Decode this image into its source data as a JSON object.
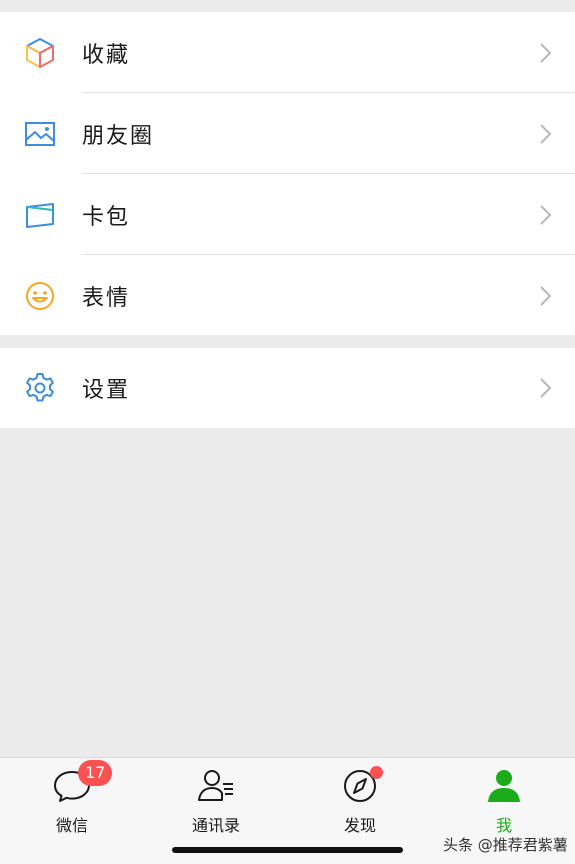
{
  "menu": {
    "group1": [
      {
        "label": "收藏",
        "icon": "favorites-cube-icon"
      },
      {
        "label": "朋友圈",
        "icon": "moments-picture-icon"
      },
      {
        "label": "卡包",
        "icon": "card-wallet-icon"
      },
      {
        "label": "表情",
        "icon": "smiley-face-icon"
      }
    ],
    "group2": [
      {
        "label": "设置",
        "icon": "gear-icon"
      }
    ]
  },
  "tabbar": {
    "tabs": [
      {
        "label": "微信",
        "icon": "chat-bubble-icon",
        "badge": "17"
      },
      {
        "label": "通讯录",
        "icon": "contacts-icon"
      },
      {
        "label": "发现",
        "icon": "compass-icon",
        "dot": true
      },
      {
        "label": "我",
        "icon": "person-icon",
        "active": true
      }
    ]
  },
  "colors": {
    "accent_green": "#1aad19",
    "badge_red": "#fa5151",
    "background": "#ebebeb"
  },
  "watermark": "头条 @推荐君紫薯"
}
